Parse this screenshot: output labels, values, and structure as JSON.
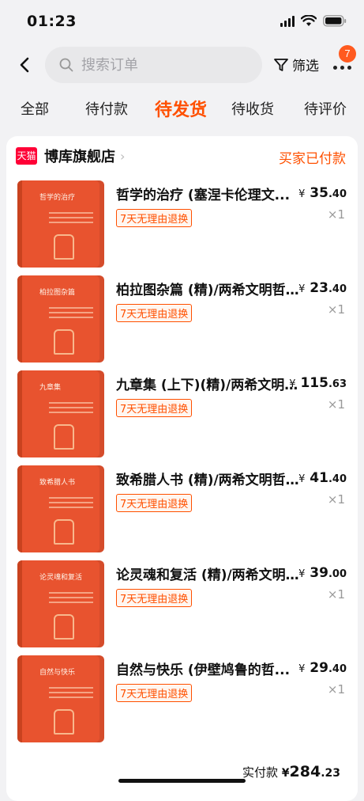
{
  "status_bar": {
    "time": "01:23"
  },
  "header": {
    "search_placeholder": "搜索订单",
    "filter_label": "筛选",
    "badge_count": "7"
  },
  "tabs": [
    {
      "label": "全部"
    },
    {
      "label": "待付款"
    },
    {
      "label": "待发货",
      "active": true
    },
    {
      "label": "待收货"
    },
    {
      "label": "待评价"
    }
  ],
  "shop": {
    "platform_badge": "天猫",
    "name": "博库旗舰店",
    "order_status": "买家已付款"
  },
  "items": [
    {
      "title": "哲学的治疗 (塞涅卡伦理文...",
      "price_yen": "¥",
      "price_int": "35",
      "price_dec": ".40",
      "tag": "7天无理由退换",
      "qty": "×1",
      "cover_title": "哲学的治疗"
    },
    {
      "title": "柏拉图杂篇 (精)/两希文明哲...",
      "price_yen": "¥",
      "price_int": "23",
      "price_dec": ".40",
      "tag": "7天无理由退换",
      "qty": "×1",
      "cover_title": "柏拉图杂篇"
    },
    {
      "title": "九章集 (上下)(精)/两希文明...",
      "price_yen": "¥",
      "price_int": "115",
      "price_dec": ".63",
      "tag": "7天无理由退换",
      "qty": "×1",
      "cover_title": "九章集"
    },
    {
      "title": "致希腊人书 (精)/两希文明哲...",
      "price_yen": "¥",
      "price_int": "41",
      "price_dec": ".40",
      "tag": "7天无理由退换",
      "qty": "×1",
      "cover_title": "致希腊人书"
    },
    {
      "title": "论灵魂和复活 (精)/两希文明...",
      "price_yen": "¥",
      "price_int": "39",
      "price_dec": ".00",
      "tag": "7天无理由退换",
      "qty": "×1",
      "cover_title": "论灵魂和复活"
    },
    {
      "title": "自然与快乐 (伊壁鸠鲁的哲...",
      "price_yen": "¥",
      "price_int": "29",
      "price_dec": ".40",
      "tag": "7天无理由退换",
      "qty": "×1",
      "cover_title": "自然与快乐"
    }
  ],
  "total": {
    "label": "实付款",
    "yen": "¥",
    "int": "284",
    "dec": ".23"
  },
  "colors": {
    "accent": "#ff5000",
    "tmall": "#ff0036",
    "cover": "#e8532f"
  }
}
